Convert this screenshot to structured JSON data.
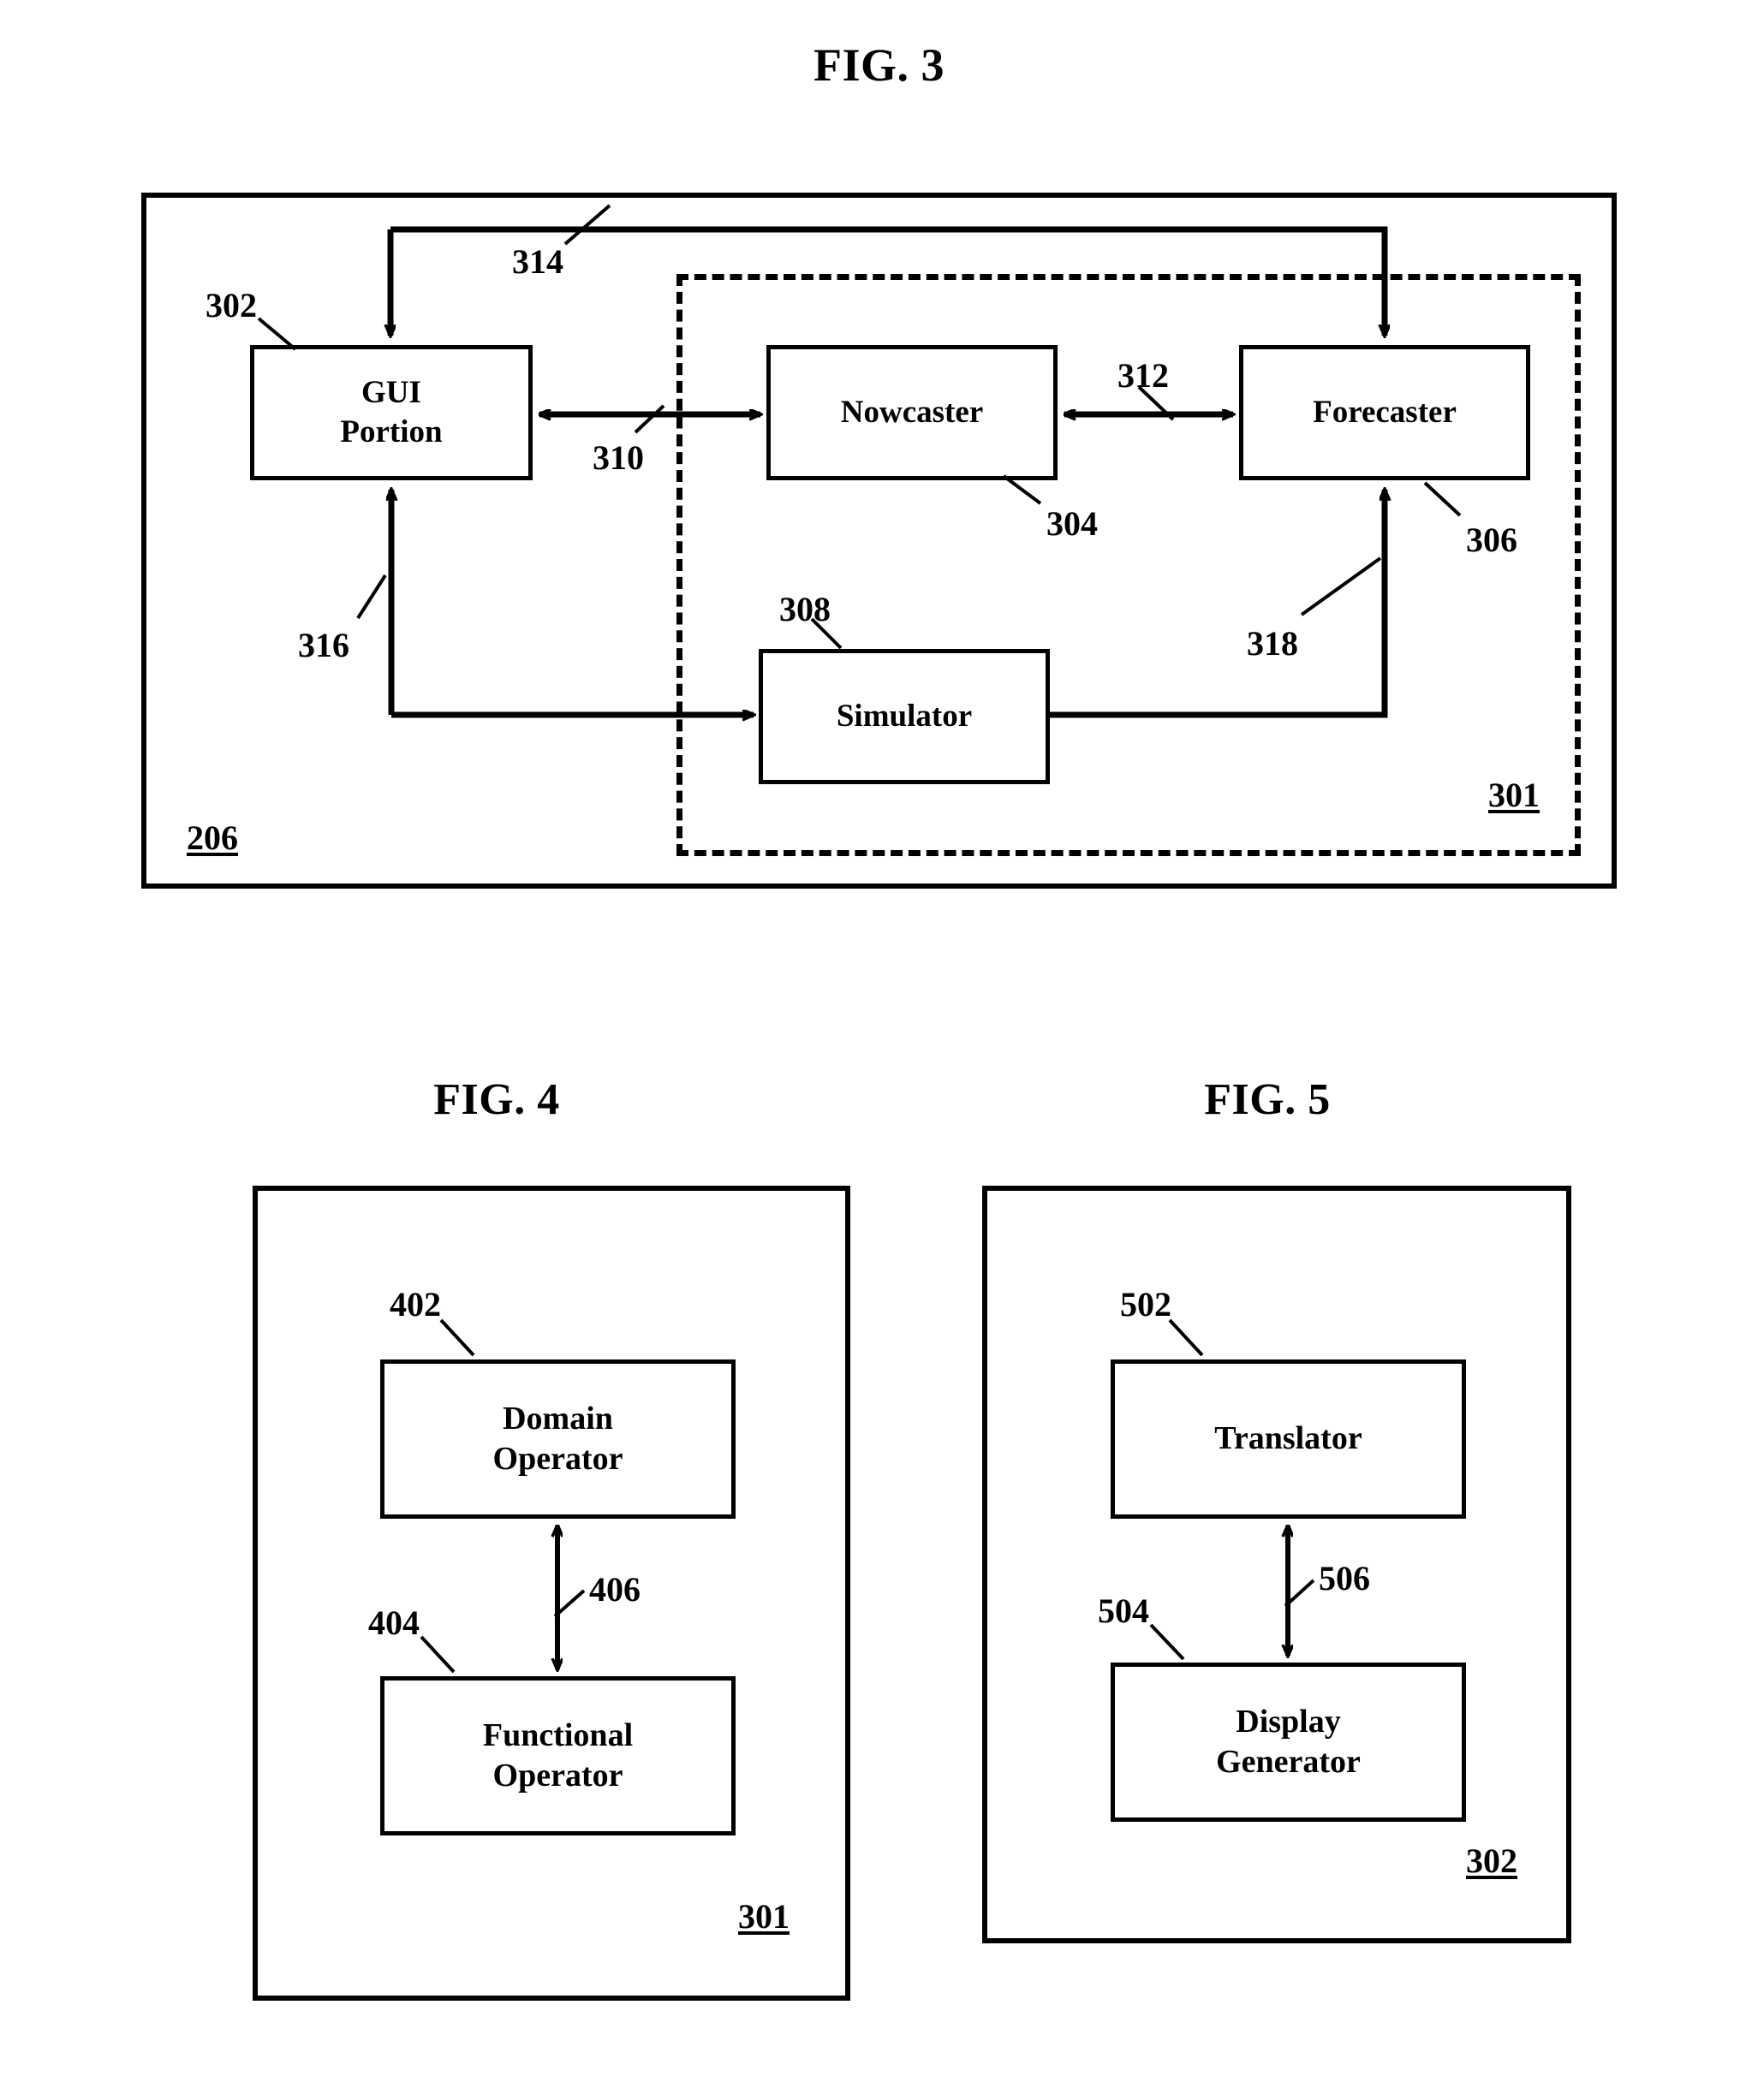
{
  "figures": [
    {
      "id": "fig3",
      "title": "FIG. 3",
      "outer_ref": "206",
      "inner_ref": "301",
      "nodes": [
        {
          "key": "gui_portion",
          "label": "GUI\nPortion",
          "ref": "302"
        },
        {
          "key": "nowcaster",
          "label": "Nowcaster",
          "ref": "304"
        },
        {
          "key": "forecaster",
          "label": "Forecaster",
          "ref": "306"
        },
        {
          "key": "simulator",
          "label": "Simulator",
          "ref": "308"
        }
      ],
      "connector_refs": [
        "310",
        "312",
        "314",
        "316",
        "318"
      ]
    },
    {
      "id": "fig4",
      "title": "FIG. 4",
      "outer_ref": "301",
      "nodes": [
        {
          "key": "domain_operator",
          "label": "Domain\nOperator",
          "ref": "402"
        },
        {
          "key": "functional_operator",
          "label": "Functional\nOperator",
          "ref": "404"
        }
      ],
      "connector_refs": [
        "406"
      ]
    },
    {
      "id": "fig5",
      "title": "FIG. 5",
      "outer_ref": "302",
      "nodes": [
        {
          "key": "translator",
          "label": "Translator",
          "ref": "502"
        },
        {
          "key": "display_generator",
          "label": "Display\nGenerator",
          "ref": "504"
        }
      ],
      "connector_refs": [
        "506"
      ]
    }
  ],
  "fig3": {
    "title": "FIG. 3",
    "outer_ref": "206",
    "inner_ref": "301",
    "gui_portion_line1": "GUI",
    "gui_portion_line2": "Portion",
    "gui_portion_ref": "302",
    "nowcaster_label": "Nowcaster",
    "nowcaster_ref": "304",
    "forecaster_label": "Forecaster",
    "forecaster_ref": "306",
    "simulator_label": "Simulator",
    "simulator_ref": "308",
    "ref_310": "310",
    "ref_312": "312",
    "ref_314": "314",
    "ref_316": "316",
    "ref_318": "318"
  },
  "fig4": {
    "title": "FIG. 4",
    "outer_ref": "301",
    "domain_operator_line1": "Domain",
    "domain_operator_line2": "Operator",
    "domain_operator_ref": "402",
    "functional_operator_line1": "Functional",
    "functional_operator_line2": "Operator",
    "functional_operator_ref": "404",
    "ref_406": "406"
  },
  "fig5": {
    "title": "FIG. 5",
    "outer_ref": "302",
    "translator_label": "Translator",
    "translator_ref": "502",
    "display_generator_line1": "Display",
    "display_generator_line2": "Generator",
    "display_generator_ref": "504",
    "ref_506": "506"
  },
  "colors": {
    "ink": "#000000",
    "paper": "#ffffff"
  }
}
